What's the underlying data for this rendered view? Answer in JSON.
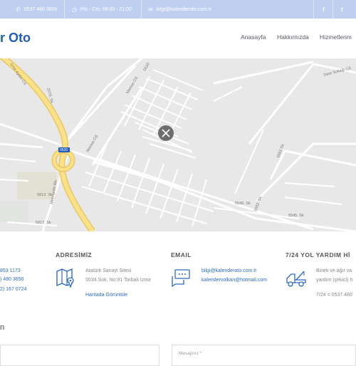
{
  "topbar": {
    "phone": "0537 480 3656",
    "hours": "Pts - Cts: 08:00 - 21:00",
    "email": "bilgi@kalenderoto.com.tr",
    "phone_icon": "phone-icon",
    "clock_icon": "clock-icon",
    "mail_icon": "mail-icon",
    "facebook": "f",
    "twitter": "t"
  },
  "header": {
    "logo": "r Oto",
    "nav": [
      "Anasayfa",
      "Hakkımızda",
      "Hizmetlerim"
    ]
  },
  "map": {
    "labels": {
      "izmir_aydin": "İzmir Aydın Cd.",
      "s2570": "2570. Sk",
      "s5530": "5530",
      "manisa1": "Manisa Cd.",
      "manisa2": "Manisa Cd.",
      "s0530": "0530",
      "metropolis": "Metropolis Blv.",
      "s5813": "5813. Sk",
      "s5817": "5817. Sk",
      "s5549": "5549. Sk",
      "s5545": "5545. Sk",
      "s5562": "5562. Sk",
      "s5562b": "5562 Sk",
      "dere": "Dere Sokağı Cd."
    },
    "close_icon": "close-icon"
  },
  "contact": {
    "phone_col": {
      "lines": [
        "853 1173",
        ") 480 3656",
        "2) 167 0724"
      ]
    },
    "address": {
      "title": "ADRESİMİZ",
      "line1": "Atatürk Sanayi Sitesi",
      "line2": "5534 Sok. No:91 Torbalı İzmir",
      "map_link": "Haritada Görüntüle",
      "icon": "map-icon"
    },
    "email": {
      "title": "EMAIL",
      "line1": "bilgi@kalenderoto.com.tr",
      "line2": "kalendervolkan@hotmail.com",
      "icon": "chat-icon"
    },
    "tow": {
      "title": "7/24 YOL YARDIM Hİ",
      "line1": "Binek ve ağır va",
      "line2": "yardım (çekici) h",
      "line3": "7/24 = 0537 480",
      "icon": "tow-truck-icon"
    }
  },
  "form": {
    "title": "n",
    "message_placeholder": "Mesajınız *"
  },
  "colors": {
    "brand": "#1f5dbb",
    "topbar": "#bfcff2",
    "link": "#2d6ac4"
  }
}
